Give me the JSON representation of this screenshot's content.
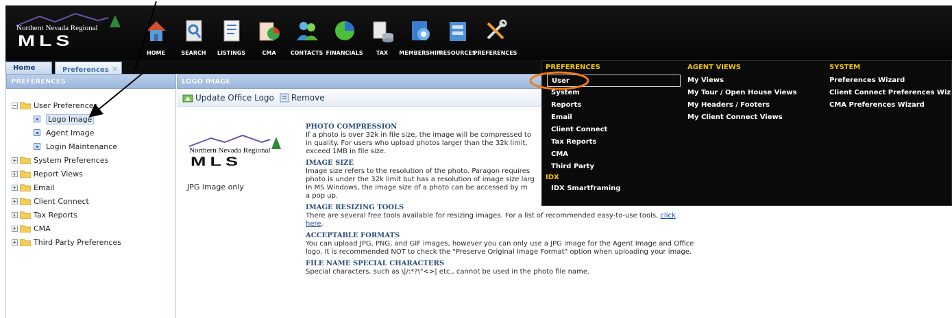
{
  "brand": {
    "line1": "Northern Nevada Regional",
    "line2": "MLS"
  },
  "nav": [
    {
      "label": "HOME",
      "icon": "house-icon"
    },
    {
      "label": "SEARCH",
      "icon": "search-icon"
    },
    {
      "label": "LISTINGS",
      "icon": "listings-icon"
    },
    {
      "label": "CMA",
      "icon": "cma-icon"
    },
    {
      "label": "CONTACTS",
      "icon": "contacts-icon"
    },
    {
      "label": "FINANCIALS",
      "icon": "pie-chart-icon"
    },
    {
      "label": "TAX",
      "icon": "tax-icon"
    },
    {
      "label": "MEMBERSHIP",
      "icon": "membership-icon"
    },
    {
      "label": "RESOURCES",
      "icon": "resources-icon"
    },
    {
      "label": "PREFERENCES",
      "icon": "tools-icon"
    }
  ],
  "tabs": {
    "home": "Home",
    "preferences": "Preferences",
    "close": "✕"
  },
  "left": {
    "title": "PREFERENCES",
    "tree": {
      "user_prefs": "User Preferences",
      "logo_image": "Logo Image",
      "agent_image": "Agent Image",
      "login_maint": "Login Maintenance",
      "system_prefs": "System Preferences",
      "report_views": "Report Views",
      "email": "Email",
      "client_connect": "Client Connect",
      "tax_reports": "Tax Reports",
      "cma": "CMA",
      "third_party": "Third Party Preferences"
    }
  },
  "main": {
    "title": "LOGO IMAGE",
    "update_btn": "Update Office Logo",
    "remove_btn": "Remove",
    "jpg_note": "JPG image only",
    "sections": {
      "s1_h": "PHOTO COMPRESSION",
      "s1_t": "If a photo is over 32k in file size, the image will be compressed to",
      "s1_t2": "in quality. For users who upload photos larger than the 32k limit,",
      "s1_t3": "exceed 1MB in file size.",
      "s2_h": "IMAGE SIZE",
      "s2_t": "Image size refers to the resolution of the photo. Paragon requires",
      "s2_t2": "photo is under the 32k limit but has a resolution of image size larg",
      "s2_t3": "In MS Windows, the image size of a photo can be accessed by m",
      "s2_t4": "a pop up.",
      "s3_h": "IMAGE RESIZING TOOLS",
      "s3_t": "There are several free tools available for resizing images. For a list of recommended easy-to-use tools,",
      "s3_link1": "click",
      "s3_link2": "here",
      "s3_end": ".",
      "s4_h": "ACCEPTABLE FORMATS",
      "s4_t": "You can upload JPG, PNG, and GIF images, however you can only use a JPG image for the Agent Image and Office logo. It is recommended NOT to check the \"Preserve Original Image Format\" option when uploading your image.",
      "s5_h": "FILE NAME SPECIAL CHARACTERS",
      "s5_t": "Special characters, such as \\|/:*?\\\"<>| etc., cannot be used in the photo file name."
    }
  },
  "menu": {
    "prefs_head": "PREFERENCES",
    "prefs_items": [
      "User",
      "System",
      "Reports",
      "Email",
      "Client Connect",
      "Tax Reports",
      "CMA",
      "Third Party"
    ],
    "idx_head": "IDX",
    "idx_items": [
      "IDX Smartframing"
    ],
    "agent_head": "AGENT VIEWS",
    "agent_items": [
      "My Views",
      "My Tour / Open House Views",
      "My Headers / Footers",
      "My Client Connect Views"
    ],
    "system_head": "SYSTEM",
    "system_items": [
      "Preferences Wizard",
      "Client Connect Preferences Wiz",
      "CMA Preferences Wizard"
    ]
  },
  "colors": {
    "menu_header": "#f2c400",
    "highlight_circle": "#f07a1a",
    "panel_header": "#a9c0e2"
  }
}
